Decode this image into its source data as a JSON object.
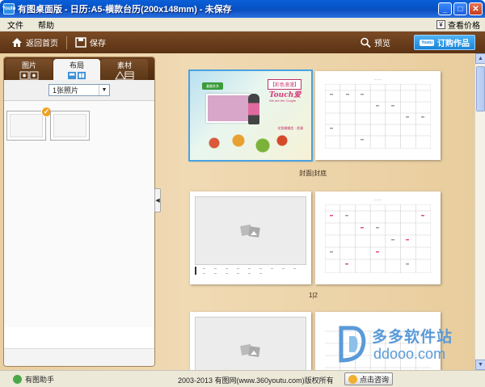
{
  "window": {
    "title": "有图桌面版 - 日历:A5-横款台历(200x148mm) - 未保存",
    "app_icon_label": "Youtu",
    "minimize": "_",
    "maximize": "□",
    "close": "✕"
  },
  "menu": {
    "items": [
      "文件",
      "帮助"
    ],
    "price_label": "查看价格",
    "price_icon": "¥"
  },
  "toolbar": {
    "home_label": "返回首页",
    "save_label": "保存",
    "preview_label": "预览",
    "order_label": "订购作品",
    "order_logo": "Youtu"
  },
  "left_panel": {
    "tabs": [
      {
        "label": "图片",
        "icon": "photos-icon"
      },
      {
        "label": "布局",
        "icon": "layout-icon"
      },
      {
        "label": "素材",
        "icon": "material-icon"
      }
    ],
    "active_tab": 1,
    "select_value": "1张照片",
    "select_arrow": "▼",
    "check_mark": "✓",
    "collapse_arrow": "◀"
  },
  "canvas": {
    "cover": {
      "ribbon": "童趣多多",
      "badge_title": "【彩色浪漫】",
      "headline": "Touch爱",
      "sub": "We are the Couple",
      "footnote": "花香蝴蝶恋 · 浪漫"
    },
    "captions": {
      "spread1": "封面|封底",
      "spread2": "1|2"
    }
  },
  "scrollbar": {
    "up": "▲",
    "down": "▼"
  },
  "watermark": {
    "cn": "多多软件站",
    "en": "ddooo.com"
  },
  "status": {
    "assistant_label": "有图助手",
    "copyright": "2003-2013 有图网(www.360youtu.com)版权所有",
    "consult_label": "点击咨询"
  }
}
